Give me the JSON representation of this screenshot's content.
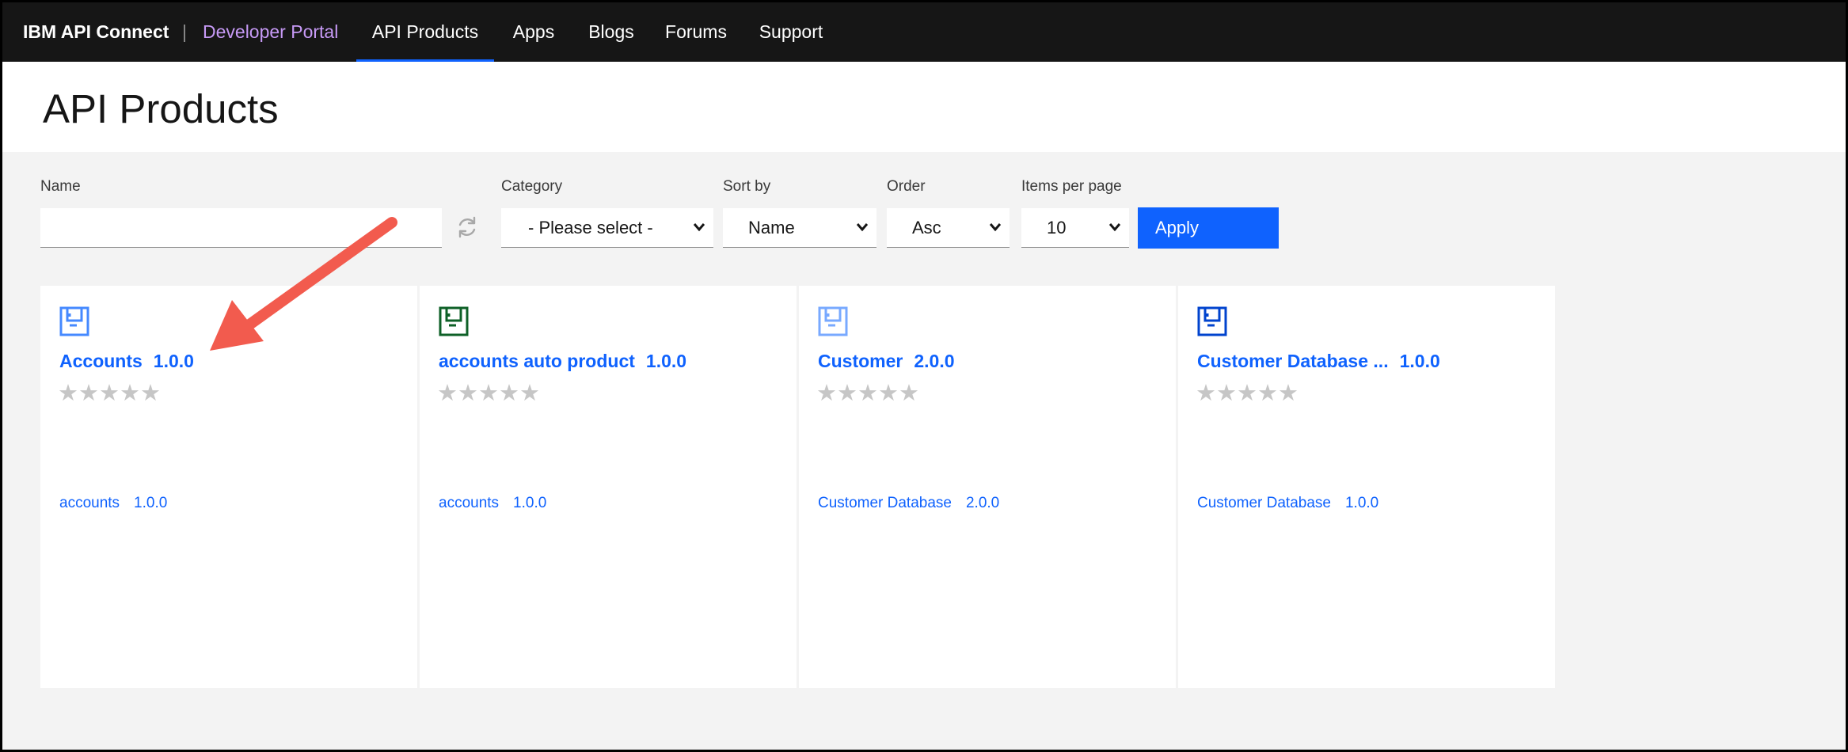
{
  "header": {
    "brand": "IBM API Connect",
    "separator": "|",
    "portal": "Developer Portal",
    "nav": [
      {
        "label": "API Products",
        "active": true
      },
      {
        "label": "Apps",
        "active": false
      },
      {
        "label": "Blogs",
        "active": false
      },
      {
        "label": "Forums",
        "active": false
      },
      {
        "label": "Support",
        "active": false
      }
    ]
  },
  "page": {
    "title": "API Products"
  },
  "filters": {
    "name_label": "Name",
    "name_value": "",
    "category_label": "Category",
    "category_value": "- Please select -",
    "sort_label": "Sort by",
    "sort_value": "Name",
    "order_label": "Order",
    "order_value": "Asc",
    "items_label": "Items per page",
    "items_value": "10",
    "apply_label": "Apply"
  },
  "products": [
    {
      "name": "Accounts",
      "version": "1.0.0",
      "meta_name": "accounts",
      "meta_version": "1.0.0",
      "icon_color": "#4589ff",
      "stars": "★★★★★",
      "rating": 0
    },
    {
      "name": "accounts auto product",
      "version": "1.0.0",
      "meta_name": "accounts",
      "meta_version": "1.0.0",
      "icon_color": "#0e6027",
      "stars": "★★★★★",
      "rating": 0
    },
    {
      "name": "Customer",
      "version": "2.0.0",
      "meta_name": "Customer Database",
      "meta_version": "2.0.0",
      "icon_color": "#78a9ff",
      "stars": "★★★★★",
      "rating": 0
    },
    {
      "name": "Customer Database ...",
      "version": "1.0.0",
      "meta_name": "Customer Database",
      "meta_version": "1.0.0",
      "icon_color": "#0043ce",
      "stars": "★★★★★",
      "rating": 0
    }
  ],
  "colors": {
    "accent": "#0f62fe",
    "annotation_arrow": "#f25b4e",
    "nav_bg": "#161616",
    "portal_text": "#c79af6"
  }
}
